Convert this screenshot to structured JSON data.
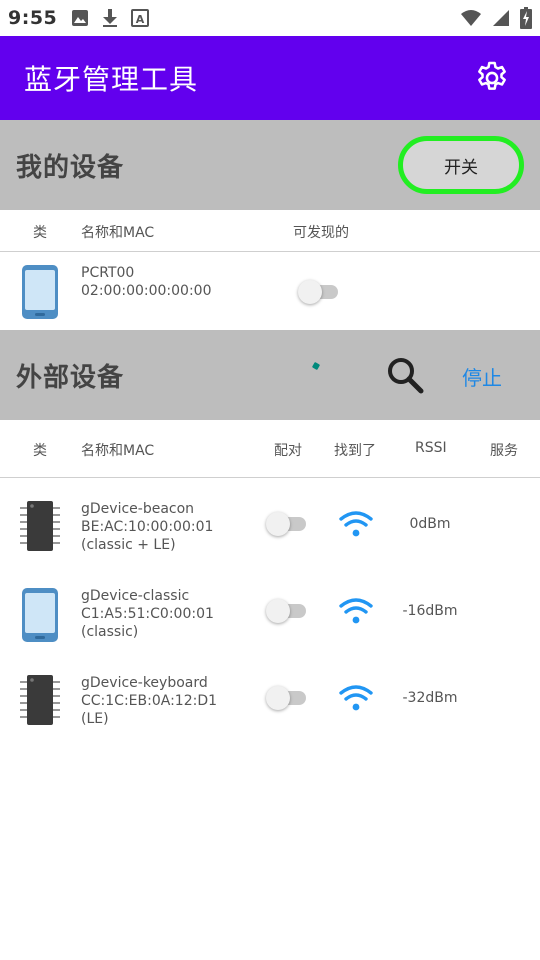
{
  "status_bar": {
    "time": "9:55",
    "left_icons": [
      "image-icon",
      "download-icon",
      "font-a-icon"
    ],
    "right_icons": [
      "wifi-status-icon",
      "signal-icon",
      "battery-charging-icon"
    ]
  },
  "app_bar": {
    "title": "蓝牙管理工具",
    "color": "#6200ee",
    "settings_icon": "gear-icon"
  },
  "my_devices": {
    "title": "我的设备",
    "toggle_label": "开关",
    "columns": {
      "type": "类",
      "name_mac": "名称和MAC",
      "discoverable": "可发现的"
    },
    "devices": [
      {
        "icon": "phone-icon",
        "name": "PCRT00",
        "mac": "02:00:00:00:00:00",
        "discoverable": false
      }
    ]
  },
  "external_devices": {
    "title": "外部设备",
    "search_icon": "search-icon",
    "stop_label": "停止",
    "columns": {
      "type": "类",
      "name_mac": "名称和MAC",
      "paired": "配对",
      "found": "找到了",
      "rssi": "RSSI",
      "service": "服务"
    },
    "devices": [
      {
        "icon": "chip-icon",
        "name": "gDevice-beacon",
        "mac": "BE:AC:10:00:00:01",
        "kind": "(classic + LE)",
        "paired": false,
        "rssi": "0dBm"
      },
      {
        "icon": "phone-icon",
        "name": "gDevice-classic",
        "mac": "C1:A5:51:C0:00:01",
        "kind": "(classic)",
        "paired": false,
        "rssi": "-16dBm"
      },
      {
        "icon": "chip-icon",
        "name": "gDevice-keyboard",
        "mac": "CC:1C:EB:0A:12:D1",
        "kind": "(LE)",
        "paired": false,
        "rssi": "-32dBm"
      }
    ]
  },
  "colors": {
    "accent": "#6200ee",
    "section_bg": "#bdbdbd",
    "highlight_border": "#22ee22",
    "link_blue": "#1e88e5",
    "wifi_blue": "#2196f3"
  }
}
